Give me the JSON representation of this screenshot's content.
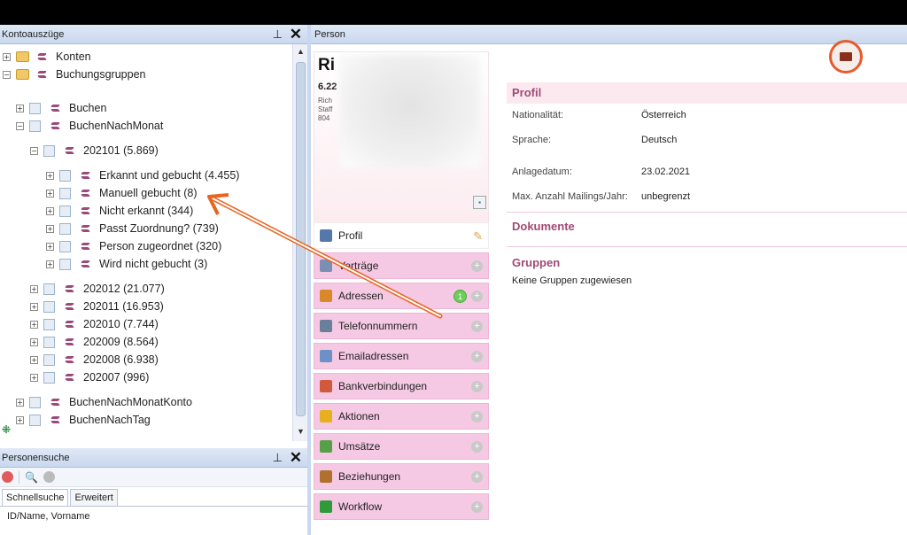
{
  "left_top": {
    "title": "Kontoauszüge",
    "tree": [
      {
        "label": "Konten",
        "kind": "folder",
        "expander": "+"
      },
      {
        "label": "Buchungsgruppen",
        "kind": "folder",
        "expander": "-"
      },
      {
        "label": "Buchen",
        "kind": "group",
        "expander": "+"
      },
      {
        "label": "BuchenNachMonat",
        "kind": "group",
        "expander": "-"
      },
      {
        "label": "202101 (5.869)",
        "kind": "group",
        "expander": "-"
      },
      {
        "label": "Erkannt und gebucht (4.455)",
        "kind": "group",
        "expander": "+"
      },
      {
        "label": "Manuell gebucht (8)",
        "kind": "group",
        "expander": "+"
      },
      {
        "label": "Nicht erkannt (344)",
        "kind": "group",
        "expander": "+"
      },
      {
        "label": "Passt Zuordnung? (739)",
        "kind": "group",
        "expander": "+"
      },
      {
        "label": "Person zugeordnet (320)",
        "kind": "group",
        "expander": "+"
      },
      {
        "label": "Wird nicht gebucht (3)",
        "kind": "group",
        "expander": "+"
      },
      {
        "label": "202012 (21.077)",
        "kind": "group",
        "expander": "+"
      },
      {
        "label": "202011 (16.953)",
        "kind": "group",
        "expander": "+"
      },
      {
        "label": "202010 (7.744)",
        "kind": "group",
        "expander": "+"
      },
      {
        "label": "202009 (8.564)",
        "kind": "group",
        "expander": "+"
      },
      {
        "label": "202008 (6.938)",
        "kind": "group",
        "expander": "+"
      },
      {
        "label": "202007 (996)",
        "kind": "group",
        "expander": "+"
      },
      {
        "label": "BuchenNachMonatKonto",
        "kind": "group",
        "expander": "+"
      },
      {
        "label": "BuchenNachTag",
        "kind": "group",
        "expander": "+"
      }
    ]
  },
  "left_bottom": {
    "title": "Personensuche",
    "tabs": [
      "Schnellsuche",
      "Erweitert"
    ],
    "field_label": "ID/Name, Vorname"
  },
  "right": {
    "title": "Person",
    "person": {
      "name": "Ri",
      "id": "6.22",
      "lines": [
        "Rich",
        "Staff",
        "804"
      ]
    },
    "nav": [
      {
        "label": "Profil",
        "icon_color": "#5577aa",
        "badge": ""
      },
      {
        "label": "Verträge",
        "icon_color": "#7a8fb3",
        "badge": ""
      },
      {
        "label": "Adressen",
        "icon_color": "#d9882a",
        "badge": "1"
      },
      {
        "label": "Telefonnummern",
        "icon_color": "#6a7f9a",
        "badge": ""
      },
      {
        "label": "Emailadressen",
        "icon_color": "#6f8fc7",
        "badge": ""
      },
      {
        "label": "Bankverbindungen",
        "icon_color": "#d25a3c",
        "badge": ""
      },
      {
        "label": "Aktionen",
        "icon_color": "#e6b020",
        "badge": ""
      },
      {
        "label": "Umsätze",
        "icon_color": "#58a048",
        "badge": ""
      },
      {
        "label": "Beziehungen",
        "icon_color": "#b07030",
        "badge": ""
      },
      {
        "label": "Workflow",
        "icon_color": "#2f9a3a",
        "badge": ""
      }
    ],
    "profil": {
      "heading": "Profil",
      "rows": [
        {
          "label": "Nationalität:",
          "value": "Österreich"
        },
        {
          "label": "Sprache:",
          "value": "Deutsch"
        },
        {
          "label": "Anlagedatum:",
          "value": "23.02.2021"
        },
        {
          "label": "Max. Anzahl Mailings/Jahr:",
          "value": "unbegrenzt"
        }
      ]
    },
    "dokumente": {
      "heading": "Dokumente"
    },
    "gruppen": {
      "heading": "Gruppen",
      "text": "Keine Gruppen zugewiesen"
    }
  },
  "colors": {
    "accent": "#a04a75",
    "nav_bg": "#f5c9e3",
    "highlight_ring": "#e65a2c",
    "arrow": "#e8641f"
  }
}
